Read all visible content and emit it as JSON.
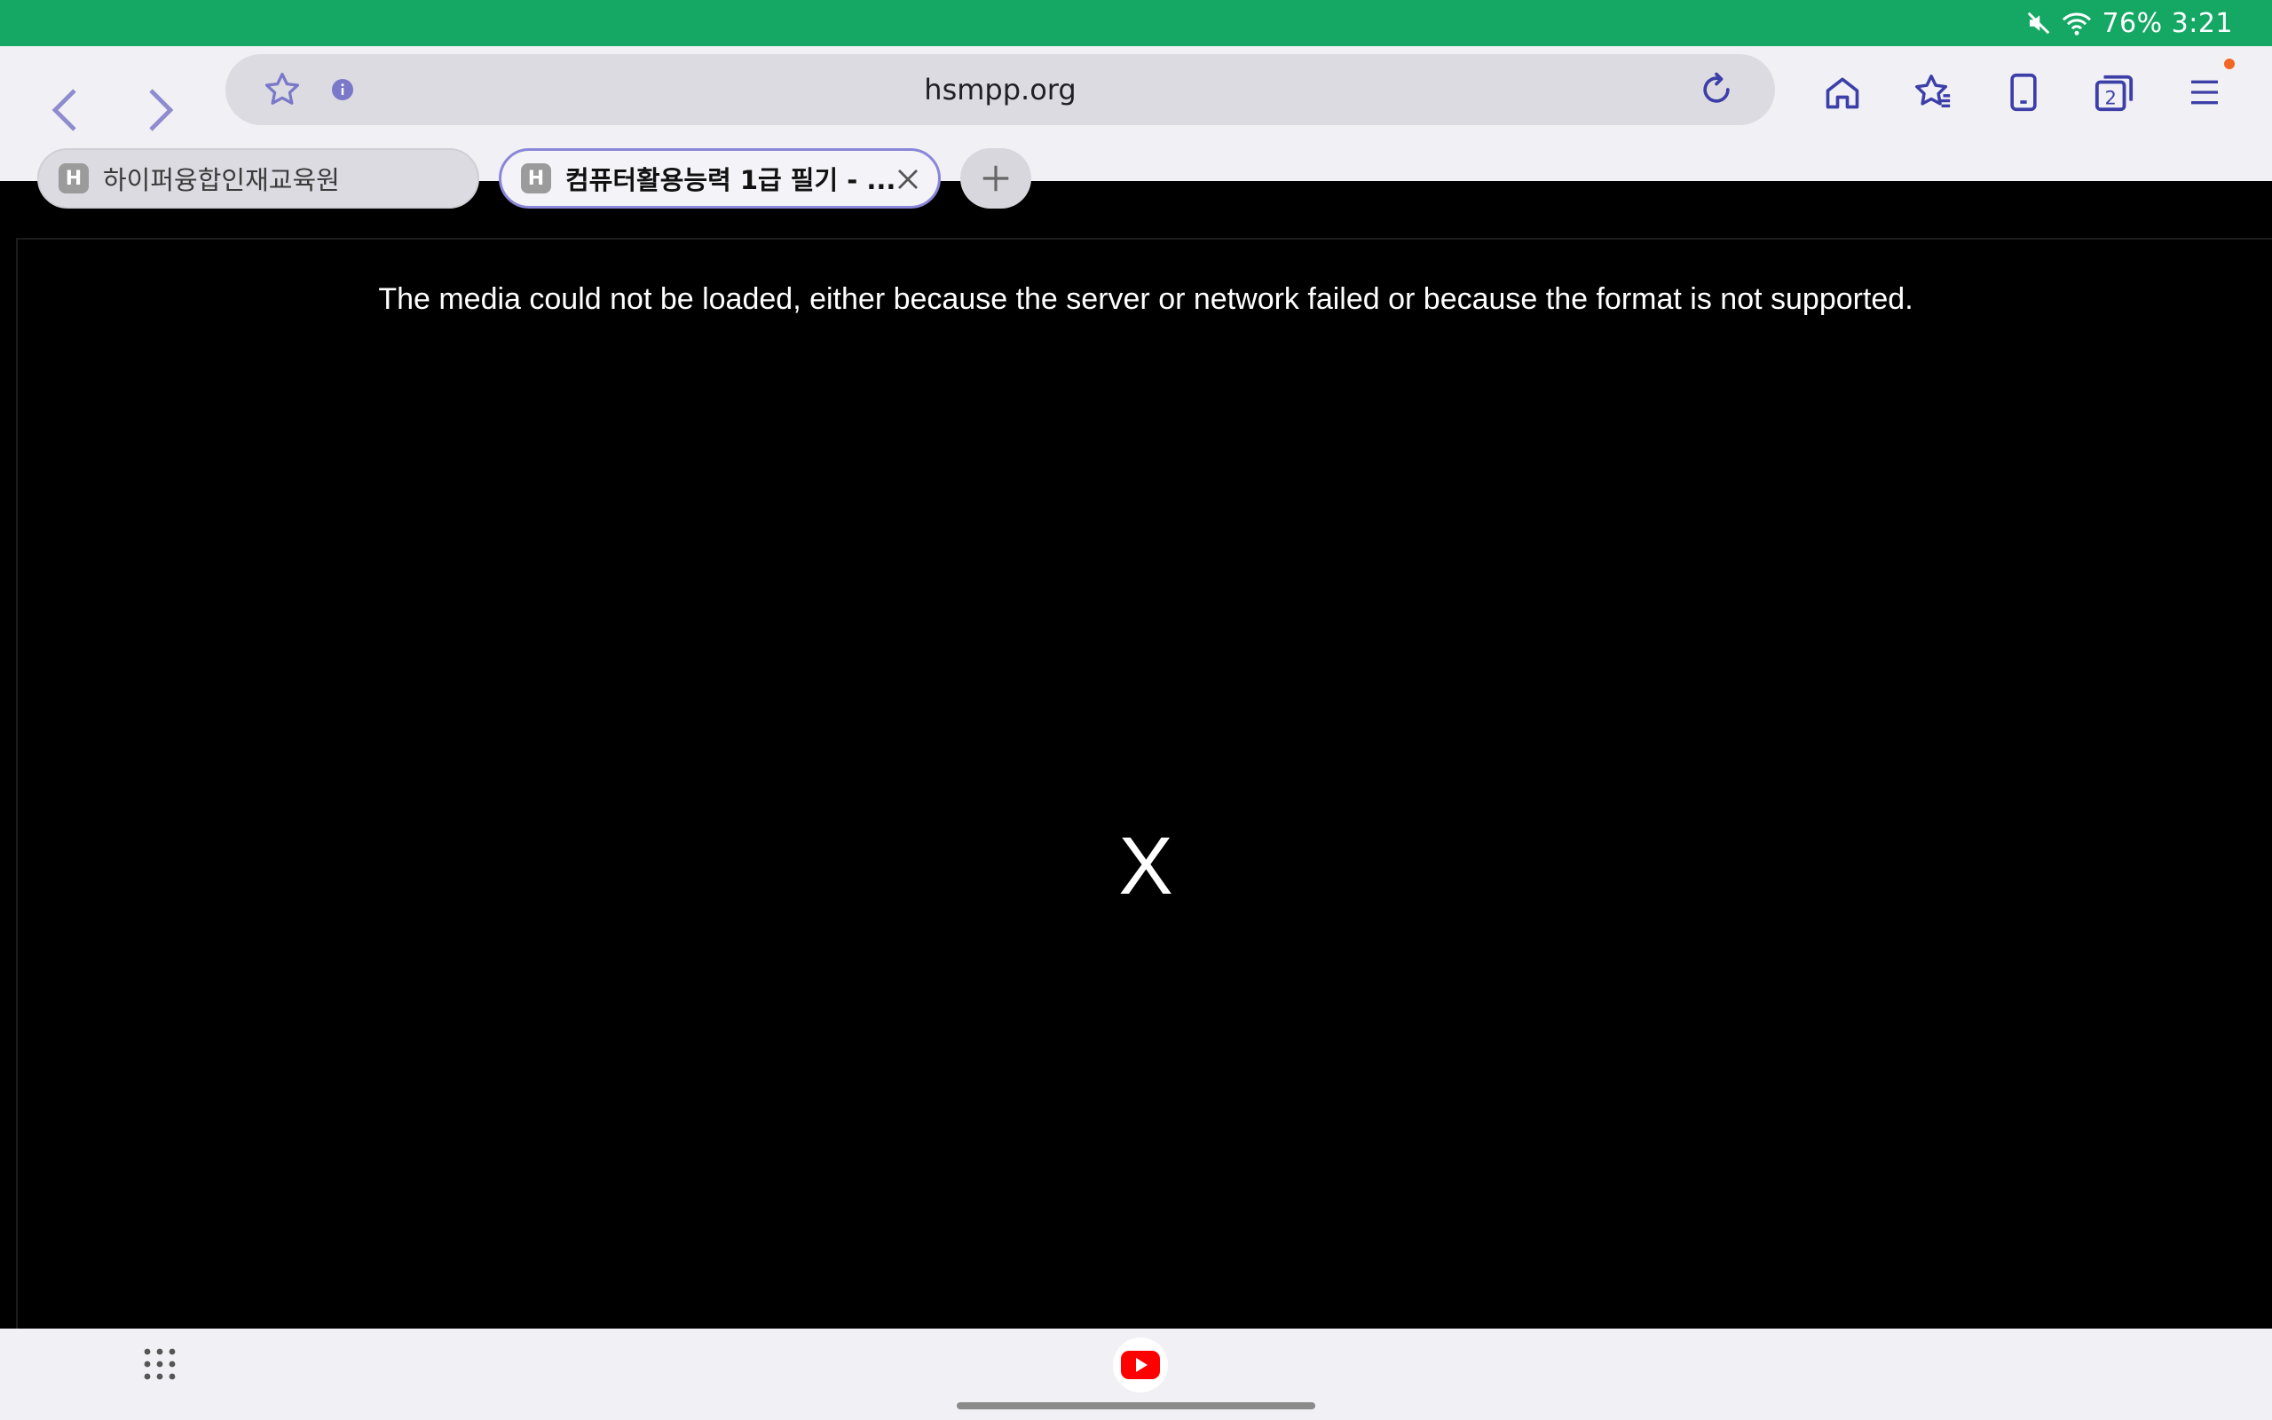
{
  "status_bar": {
    "battery": "76%",
    "time": "3:21",
    "icons": [
      "mute-icon",
      "wifi-icon"
    ],
    "bg_color": "#15a864"
  },
  "browser": {
    "url": "hsmpp.org",
    "tab_count": "2",
    "tabs": [
      {
        "favicon": "H",
        "title": "하이퍼융합인재교육원",
        "active": false
      },
      {
        "favicon": "H",
        "title": "컴퓨터활용능력 1급 필기 - ...",
        "active": true
      }
    ],
    "accent_color": "#3c3fa8"
  },
  "content": {
    "error_message": "The media could not be loaded, either because the server or network failed or because the format is not supported.",
    "error_symbol": "X"
  },
  "bottom_bar": {
    "apps": [
      "apps-grid-icon",
      "youtube-icon"
    ]
  }
}
